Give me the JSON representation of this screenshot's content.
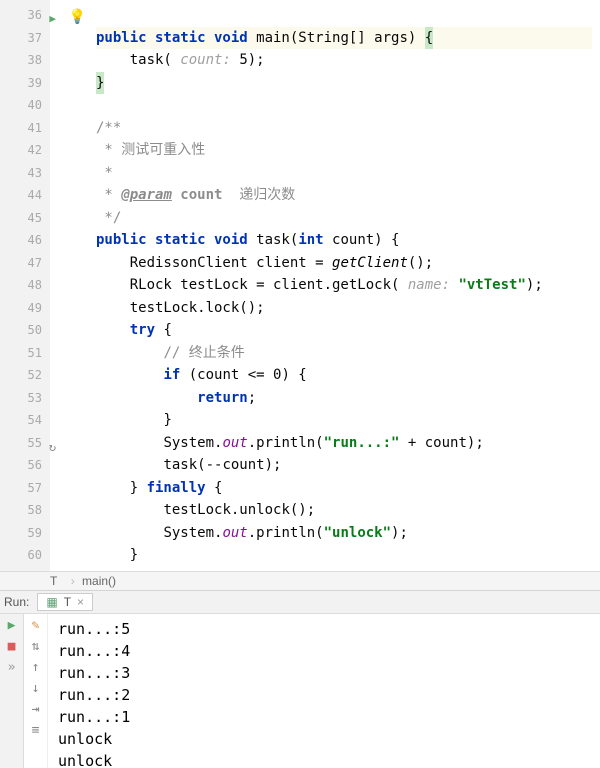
{
  "line_numbers": [
    "36",
    "37",
    "38",
    "39",
    "40",
    "41",
    "42",
    "43",
    "44",
    "45",
    "46",
    "47",
    "48",
    "49",
    "50",
    "51",
    "52",
    "53",
    "54",
    "55",
    "56",
    "57",
    "58",
    "59",
    "60"
  ],
  "code": {
    "main_sig_1": "public static void",
    "main_name": " main",
    "main_sig_2": "(String[] args) ",
    "task_call_prefix": "task(",
    "task_call_hint": " count: ",
    "task_call_arg": "5",
    "task_call_suffix": ");",
    "doc1": "/**",
    "doc2": " * 测试可重入性",
    "doc3": " *",
    "doc4a": " * ",
    "doc4_tag": "@param",
    "doc4_param": " count",
    "doc4_desc": "  递归次数",
    "doc5": " */",
    "task_sig_1": "public static void",
    "task_name": " task",
    "task_sig_2": "(",
    "task_sig_int": "int",
    "task_sig_3": " count) {",
    "l46a": "RedissonClient client = ",
    "l46b": "getClient",
    "l46c": "();",
    "l47a": "RLock testLock = client.getLock(",
    "l47hint": " name: ",
    "l47str": "\"vtTest\"",
    "l47c": ");",
    "l48": "testLock.lock();",
    "try_kw": "try",
    "try_brace": " {",
    "l50": "// 终止条件",
    "if_kw": "if",
    "l51b": " (count <= ",
    "l51num": "0",
    "l51c": ") {",
    "return_kw": "return",
    "l52b": ";",
    "l53": "}",
    "l54a": "System.",
    "l54out": "out",
    "l54b": ".println(",
    "l54str": "\"run...:\"",
    "l54c": " + count);",
    "l55": "task(--count);",
    "l56a": "} ",
    "finally_kw": "finally",
    "l56b": " {",
    "l57": "testLock.unlock();",
    "l58a": "System.",
    "l58out": "out",
    "l58b": ".println(",
    "l58str": "\"unlock\"",
    "l58c": ");",
    "l59": "}",
    "l60": "}"
  },
  "breadcrumbs": {
    "c1": "T",
    "c2": "main()"
  },
  "run": {
    "label": "Run:",
    "tab": "T",
    "output": [
      "run...:5",
      "run...:4",
      "run...:3",
      "run...:2",
      "run...:1",
      "unlock",
      "unlock"
    ]
  }
}
